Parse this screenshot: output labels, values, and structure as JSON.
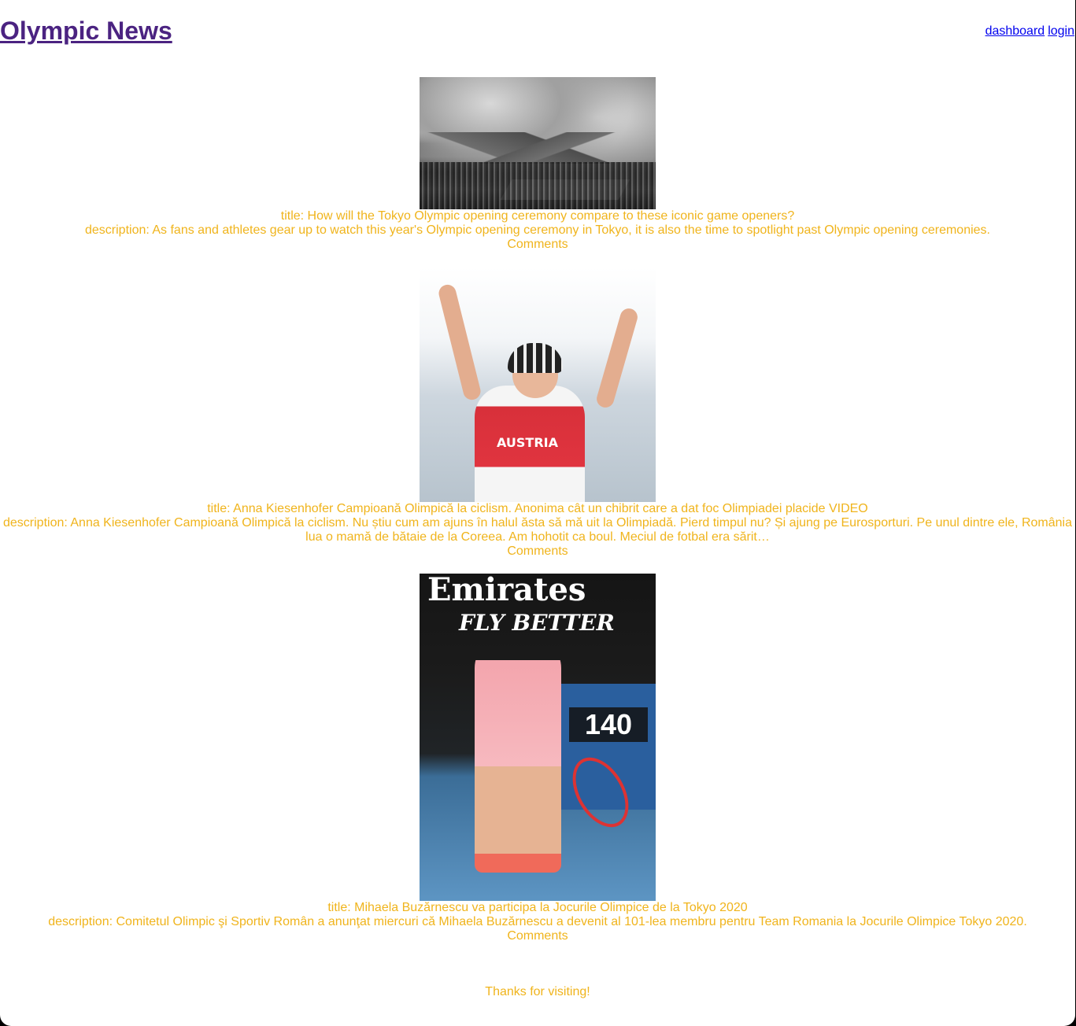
{
  "header": {
    "site_title": "Olympic News",
    "nav": {
      "dashboard": "dashboard",
      "login": "login"
    }
  },
  "articles": [
    {
      "image_alt": "Black and white photo of a historic Olympic opening ceremony in a stadium with mountains",
      "title": "title: How will the Tokyo Olympic opening ceremony compare to these iconic game openers?",
      "description": "description: As fans and athletes gear up to watch this year's Olympic opening ceremony in Tokyo, it is also the time to spotlight past Olympic opening ceremonies.",
      "comments": "Comments"
    },
    {
      "image_alt": "Cyclist in Austria jersey celebrating with arms raised",
      "jersey_text": "AUSTRIA",
      "title": "title: Anna Kiesenhofer Campioană Olimpică la ciclism. Anonima cât un chibrit care a dat foc Olimpiadei placide VIDEO",
      "description": "description: Anna Kiesenhofer Campioană Olimpică la ciclism. Nu știu cum am ajuns în halul ăsta să mă uit la Olimpiadă. Pierd timpul nu? Și ajung pe Eurosporturi. Pe unul dintre ele, România lua o mamă de bătaie de la Coreea. Am hohotit ca boul. Meciul de fotbal era sărit…",
      "comments": "Comments"
    },
    {
      "image_alt": "Tennis player in pink outfit celebrating on court",
      "banner_text": "Emirates",
      "banner_sub": "FLY BETTER",
      "speed_value": "140",
      "title": "title: Mihaela Buzărnescu va participa la Jocurile Olimpice de la Tokyo 2020",
      "description": "description: Comitetul Olimpic şi Sportiv Român a anunţat miercuri că Mihaela Buzărnescu a devenit al 101-lea membru pentru Team Romania la Jocurile Olimpice Tokyo 2020.",
      "comments": "Comments"
    }
  ],
  "footer": {
    "text": "Thanks for visiting!"
  },
  "colors": {
    "title": "#4b2381",
    "article_text": "#f0b41c",
    "link": "#0000ee"
  }
}
